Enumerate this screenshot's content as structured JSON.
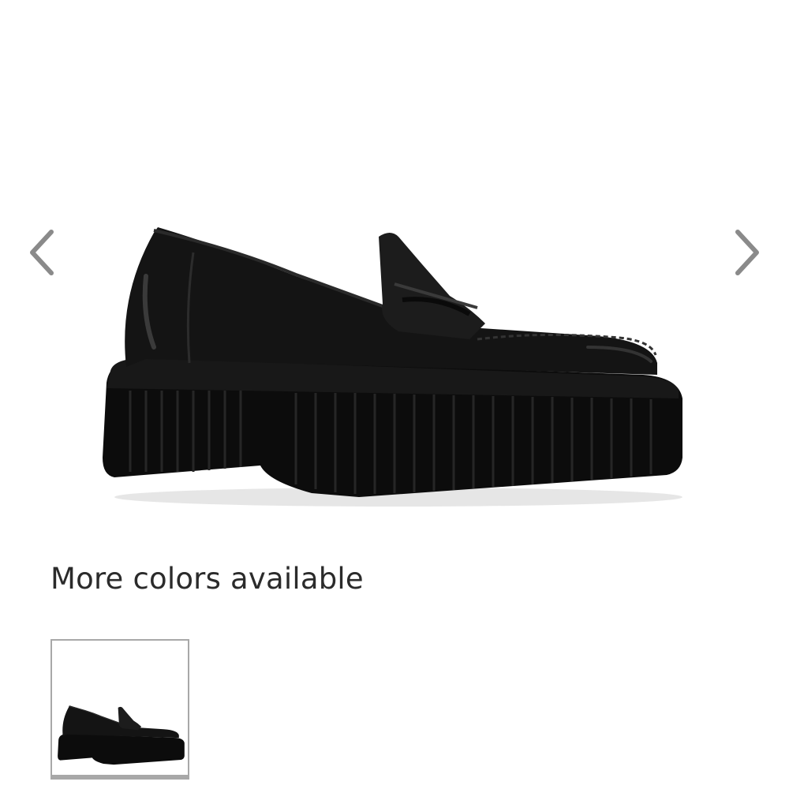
{
  "carousel": {
    "prev_icon": "chevron-left-icon",
    "next_icon": "chevron-right-icon",
    "image_alt": "Black leather platform penny loafer"
  },
  "colors": {
    "heading": "More colors available",
    "swatches": [
      {
        "name": "black",
        "selected": true
      }
    ]
  },
  "theme": {
    "chevron_color": "#8a8a8a",
    "shoe_color": "#141414",
    "sole_color": "#0c0c0c",
    "text_color": "#2b2b2b",
    "swatch_border": "#a8a8a8"
  }
}
